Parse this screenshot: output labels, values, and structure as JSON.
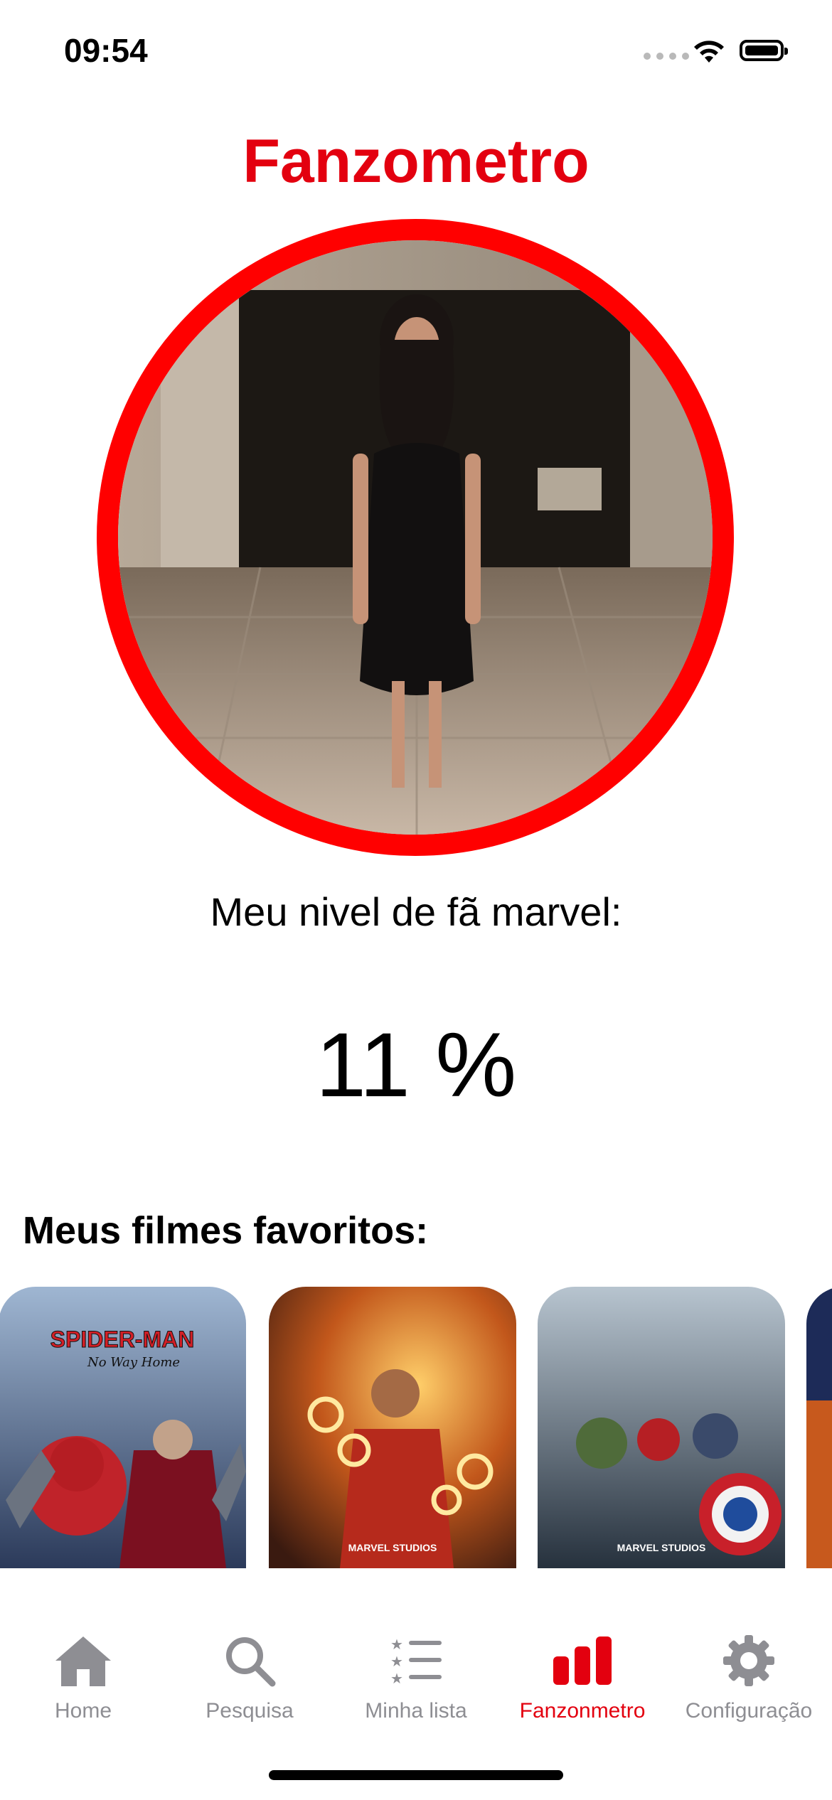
{
  "status": {
    "time": "09:54"
  },
  "header": {
    "title": "Fanzometro"
  },
  "fan_level": {
    "label": "Meu nivel de fã marvel:",
    "value": "11 %",
    "percent": 11
  },
  "favorites": {
    "title": "Meus filmes favoritos:",
    "posters": [
      {
        "title": "SPIDER-MAN",
        "subtitle": "No Way Home"
      },
      {
        "title": "MARVEL STUDIOS",
        "subtitle": ""
      },
      {
        "title": "MARVEL STUDIOS",
        "subtitle": ""
      }
    ]
  },
  "tabs": [
    {
      "label": "Home",
      "icon": "house-icon"
    },
    {
      "label": "Pesquisa",
      "icon": "search-icon"
    },
    {
      "label": "Minha lista",
      "icon": "list-icon"
    },
    {
      "label": "Fanzonmetro",
      "icon": "bar-chart-icon",
      "active": true
    },
    {
      "label": "Configuração",
      "icon": "gear-icon"
    }
  ],
  "colors": {
    "accent": "#e3000f",
    "ring": "#ff0000",
    "tab_inactive": "#8e8e93"
  }
}
